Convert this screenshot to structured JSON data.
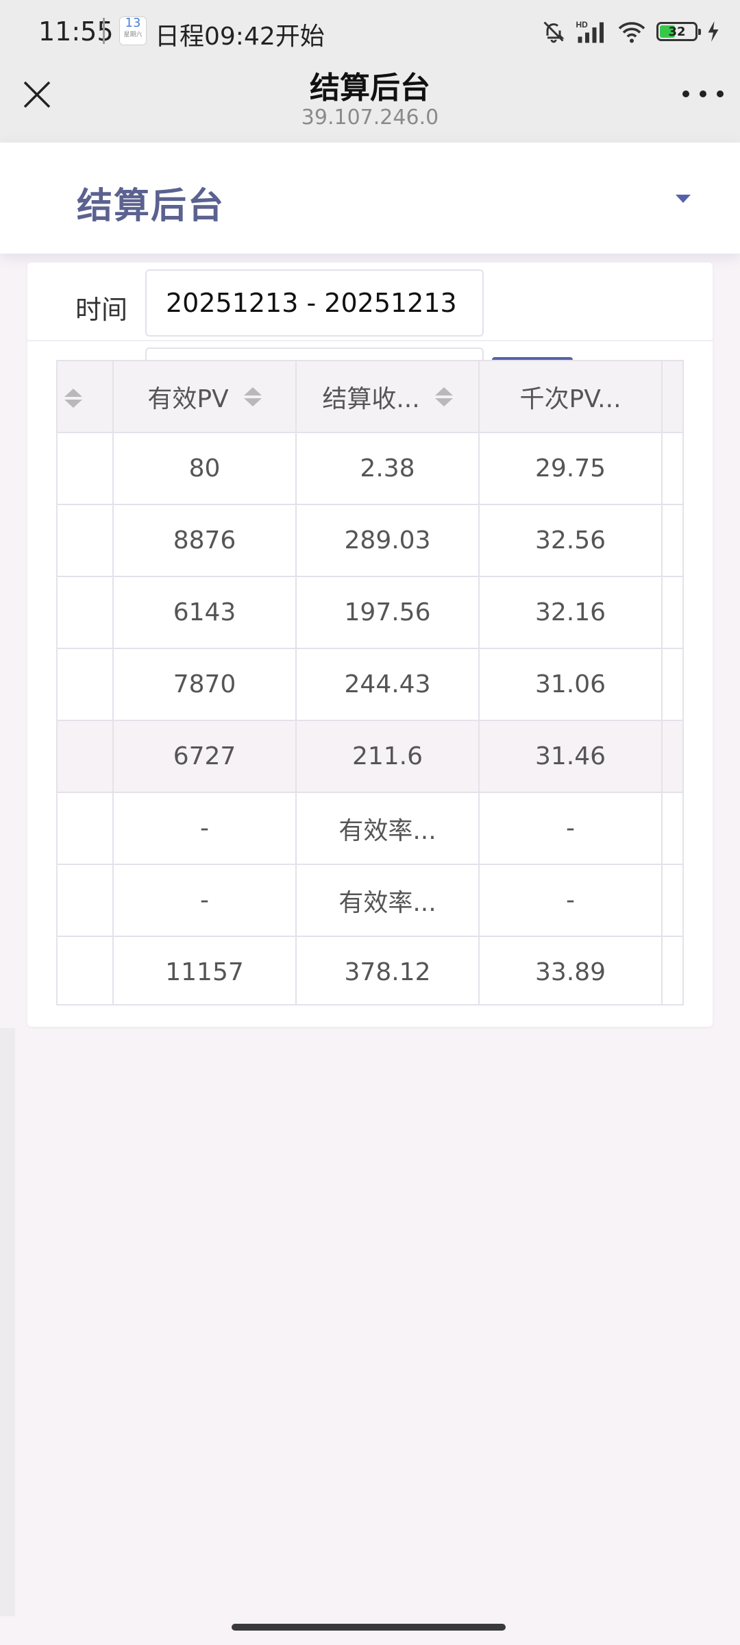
{
  "status_bar": {
    "time": "11:55",
    "calendar_day": "13",
    "calendar_sub": "星期六",
    "schedule": "日程09:42开始",
    "battery": "32"
  },
  "title_bar": {
    "title": "结算后台",
    "subtitle": "39.107.246.0"
  },
  "app_header": {
    "title": "结算后台"
  },
  "filter": {
    "time_label": "时间",
    "date_range": "20251213 - 20251213"
  },
  "table": {
    "columns": [
      "有效PV",
      "结算收...",
      "千次PV..."
    ],
    "rows": [
      [
        "80",
        "2.38",
        "29.75"
      ],
      [
        "8876",
        "289.03",
        "32.56"
      ],
      [
        "6143",
        "197.56",
        "32.16"
      ],
      [
        "7870",
        "244.43",
        "31.06"
      ],
      [
        "6727",
        "211.6",
        "31.46"
      ],
      [
        "-",
        "有效率...",
        "-"
      ],
      [
        "-",
        "有效率...",
        "-"
      ],
      [
        "11157",
        "378.12",
        "33.89"
      ]
    ]
  },
  "colors": {
    "accent": "#5661a8",
    "header_title": "#5b6290",
    "battery_fill": "#37c84a"
  }
}
